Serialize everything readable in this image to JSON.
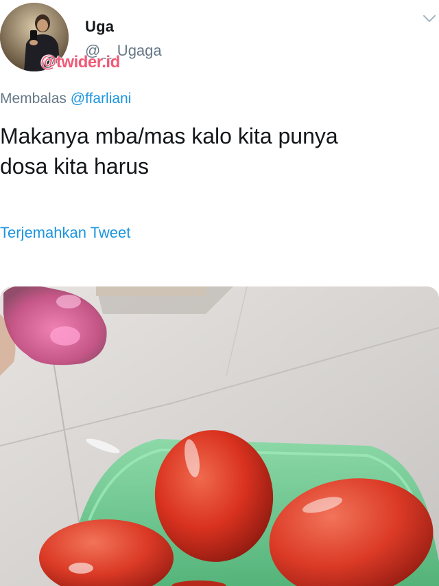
{
  "tweet": {
    "display_name": "Uga",
    "handle": "@__Ugaga",
    "watermark": "@twider.id",
    "reply_prefix": "Membalas",
    "reply_mention": "@ffarliani",
    "text_line_1": "Makanya mba/mas kalo kita punya",
    "text_line_2": "dosa kita harus",
    "translate_label": "Terjemahkan Tweet"
  },
  "icons": {
    "menu_caret": "chevron-down-icon",
    "avatar": "user-avatar"
  },
  "colors": {
    "link": "#1b95e0",
    "secondary_text": "#657786",
    "primary_text": "#14171a",
    "watermark": "#f05a78"
  },
  "media": {
    "description_icon": "photo-tomatoes-in-green-container"
  }
}
